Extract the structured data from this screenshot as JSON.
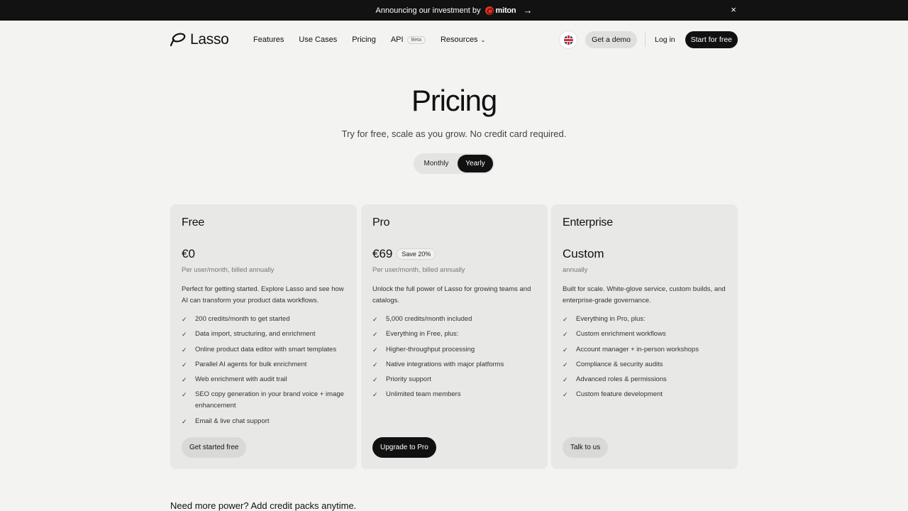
{
  "announcement": {
    "text": "Announcing our investment by",
    "brand": "miton",
    "arrow": "→",
    "close": "×"
  },
  "nav": {
    "logo": "Lasso",
    "links": [
      {
        "label": "Features"
      },
      {
        "label": "Use Cases"
      },
      {
        "label": "Pricing"
      }
    ],
    "api_label": "API",
    "api_badge": "Beta",
    "resources_label": "Resources",
    "chevron": "⌄",
    "demo_label": "Get a demo",
    "login_label": "Log in",
    "start_label": "Start for free"
  },
  "hero": {
    "title": "Pricing",
    "subtitle": "Try for free, scale as you grow. No credit card required.",
    "toggle_monthly": "Monthly",
    "toggle_yearly": "Yearly",
    "selected": "Yearly"
  },
  "plans": [
    {
      "name": "Free",
      "price": "€0",
      "badge": "",
      "billing": "Per user/month, billed annually",
      "description": "Perfect for getting started. Explore Lasso and see how AI can transform your product data workflows.",
      "features": [
        "200 credits/month to get started",
        "Data import, structuring, and enrichment",
        "Online product data editor with smart templates",
        "Parallel AI agents for bulk enrichment",
        "Web enrichment with audit trail",
        "SEO copy generation in your brand voice + image enhancement",
        "Email & live chat support"
      ],
      "cta": "Get started free"
    },
    {
      "name": "Pro",
      "price": "€69",
      "badge": "Save 20%",
      "billing": "Per user/month, billed annually",
      "description": "Unlock the full power of Lasso for growing teams and catalogs.",
      "features": [
        "5,000 credits/month included",
        "Everything in Free, plus:",
        "Higher-throughput processing",
        "Native integrations with major platforms",
        "Priority support",
        "Unlimited team members"
      ],
      "cta": "Upgrade to Pro"
    },
    {
      "name": "Enterprise",
      "price": "Custom",
      "badge": "",
      "billing": "annually",
      "description": "Built for scale. White-glove service, custom builds, and enterprise-grade governance.",
      "features": [
        "Everything in Pro, plus:",
        "Custom enrichment workflows",
        "Account manager + in-person workshops",
        "Compliance & security audits",
        "Advanced roles & permissions",
        "Custom feature development"
      ],
      "cta": "Talk to us"
    }
  ],
  "footer_heading": "Need more power? Add credit packs anytime.",
  "check_glyph": "✓",
  "colors": {
    "background": "#f3f3f2",
    "card": "#e8e8e7",
    "dark": "#111111",
    "brand_red": "#e0301e"
  }
}
